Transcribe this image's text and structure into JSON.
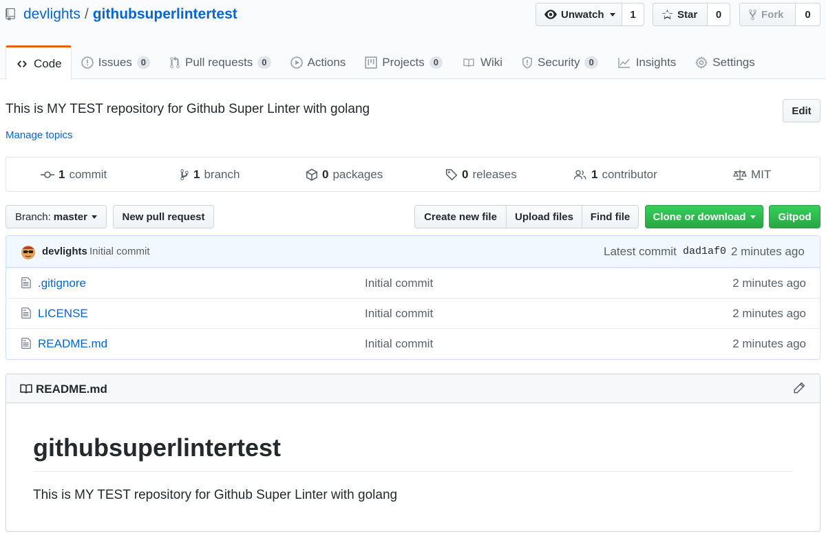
{
  "repo": {
    "owner": "devlights",
    "separator": "/",
    "name": "githubsuperlintertest"
  },
  "actions": {
    "watch_label": "Unwatch",
    "watch_count": "1",
    "star_label": "Star",
    "star_count": "0",
    "fork_label": "Fork",
    "fork_count": "0"
  },
  "tabs": [
    {
      "label": "Code",
      "icon": "code-icon"
    },
    {
      "label": "Issues",
      "count": "0",
      "icon": "issue-icon"
    },
    {
      "label": "Pull requests",
      "count": "0",
      "icon": "pull-request-icon"
    },
    {
      "label": "Actions",
      "icon": "play-icon"
    },
    {
      "label": "Projects",
      "count": "0",
      "icon": "project-icon"
    },
    {
      "label": "Wiki",
      "icon": "book-icon"
    },
    {
      "label": "Security",
      "count": "0",
      "icon": "shield-icon"
    },
    {
      "label": "Insights",
      "icon": "graph-icon"
    },
    {
      "label": "Settings",
      "icon": "gear-icon"
    }
  ],
  "about": {
    "description": "This is MY TEST repository for Github Super Linter with golang",
    "topics_link": "Manage topics",
    "edit_label": "Edit"
  },
  "summary": [
    {
      "count": "1",
      "label": "commit"
    },
    {
      "count": "1",
      "label": "branch"
    },
    {
      "count": "0",
      "label": "packages"
    },
    {
      "count": "0",
      "label": "releases"
    },
    {
      "count": "1",
      "label": "contributor"
    },
    {
      "count": "",
      "label": "MIT"
    }
  ],
  "file_nav": {
    "branch_prefix": "Branch:",
    "branch_name": "master",
    "new_pr": "New pull request",
    "create_file": "Create new file",
    "upload_files": "Upload files",
    "find_file": "Find file",
    "clone": "Clone or download",
    "gitpod": "Gitpod"
  },
  "latest_commit": {
    "author": "devlights",
    "message": "Initial commit",
    "prefix": "Latest commit",
    "sha": "dad1af0",
    "age": "2 minutes ago"
  },
  "files": [
    {
      "name": ".gitignore",
      "message": "Initial commit",
      "age": "2 minutes ago"
    },
    {
      "name": "LICENSE",
      "message": "Initial commit",
      "age": "2 minutes ago"
    },
    {
      "name": "README.md",
      "message": "Initial commit",
      "age": "2 minutes ago"
    }
  ],
  "readme": {
    "filename": "README.md",
    "heading": "githubsuperlintertest",
    "body": "This is MY TEST repository for Github Super Linter with golang"
  },
  "colors": {
    "link": "#0366d6",
    "accent_tab": "#e36209",
    "primary_button": "#28a745",
    "commit_bar": "#f1f8ff"
  }
}
